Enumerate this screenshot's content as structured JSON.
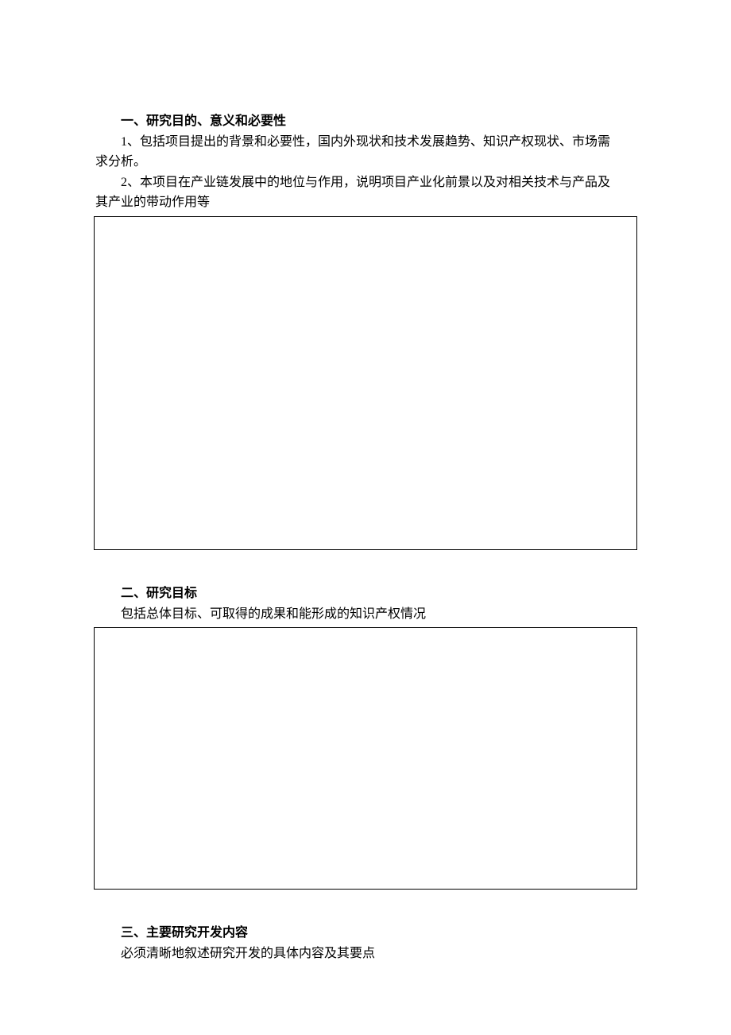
{
  "sections": [
    {
      "heading": "一、研究目的、意义和必要性",
      "lines": [
        "1、包括项目提出的背景和必要性，国内外现状和技术发展趋势、知识产权现状、市场需",
        "求分析。",
        "2、本项目在产业链发展中的地位与作用，说明项目产业化前景以及对相关技术与产品及",
        "其产业的带动作用等"
      ]
    },
    {
      "heading": "二、研究目标",
      "lines": [
        "包括总体目标、可取得的成果和能形成的知识产权情况"
      ]
    },
    {
      "heading": "三、主要研究开发内容",
      "lines": [
        "必须清晰地叙述研究开发的具体内容及其要点"
      ]
    }
  ]
}
